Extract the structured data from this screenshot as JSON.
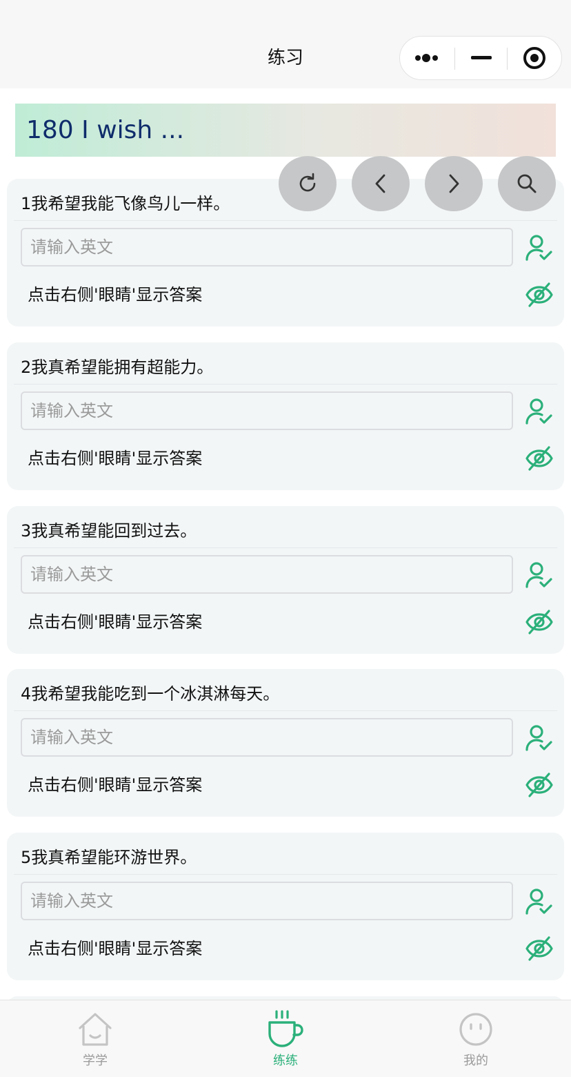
{
  "navbar": {
    "title": "练习",
    "capsule": {
      "more_icon": "more-dots-icon",
      "minimize_icon": "minimize-icon",
      "close_icon": "target-close-icon"
    }
  },
  "lesson": {
    "title": "180 I wish ..."
  },
  "floating_buttons": [
    {
      "icon": "refresh-icon"
    },
    {
      "icon": "chevron-left-icon"
    },
    {
      "icon": "chevron-right-icon"
    },
    {
      "icon": "search-icon"
    }
  ],
  "questions": [
    {
      "prompt": "1我希望我能飞像鸟儿一样。",
      "input_value": "",
      "input_placeholder": "请输入英文",
      "hint": "点击右侧'眼睛'显示答案"
    },
    {
      "prompt": "2我真希望能拥有超能力。",
      "input_value": "",
      "input_placeholder": "请输入英文",
      "hint": "点击右侧'眼睛'显示答案"
    },
    {
      "prompt": "3我真希望能回到过去。",
      "input_value": "",
      "input_placeholder": "请输入英文",
      "hint": "点击右侧'眼睛'显示答案"
    },
    {
      "prompt": "4我希望我能吃到一个冰淇淋每天。",
      "input_value": "",
      "input_placeholder": "请输入英文",
      "hint": "点击右侧'眼睛'显示答案"
    },
    {
      "prompt": "5我真希望能环游世界。",
      "input_value": "",
      "input_placeholder": "请输入英文",
      "hint": "点击右侧'眼睛'显示答案"
    }
  ],
  "tabbar": {
    "tabs": [
      {
        "label": "学学",
        "icon": "home-icon",
        "active": false
      },
      {
        "label": "练练",
        "icon": "coffee-cup-icon",
        "active": true
      },
      {
        "label": "我的",
        "icon": "smiley-face-icon",
        "active": false
      }
    ]
  },
  "colors": {
    "accent": "#2bb07a",
    "banner_text": "#0f2c6b",
    "card_bg": "#f3f6f7",
    "fab_bg": "#c6c7c8",
    "inactive_tab": "#9a9a9a"
  }
}
